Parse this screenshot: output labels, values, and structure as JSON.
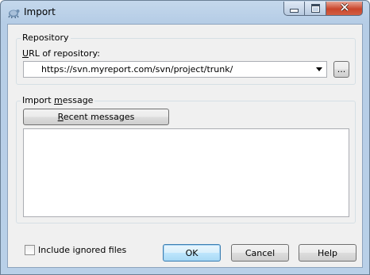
{
  "window": {
    "title": "Import"
  },
  "repository": {
    "group_label": "Repository",
    "url_label_accel": "U",
    "url_label_rest": "RL of repository:",
    "url_value": "https://svn.myreport.com/svn/project/trunk/",
    "browse_label": "..."
  },
  "import_message": {
    "group_label_pre": "Import ",
    "group_label_accel": "m",
    "group_label_post": "essage",
    "recent_accel": "R",
    "recent_rest": "ecent messages",
    "text": ""
  },
  "options": {
    "include_ignored_label": "Include ignored files",
    "include_ignored_checked": false
  },
  "buttons": {
    "ok": "OK",
    "cancel": "Cancel",
    "help": "Help"
  }
}
